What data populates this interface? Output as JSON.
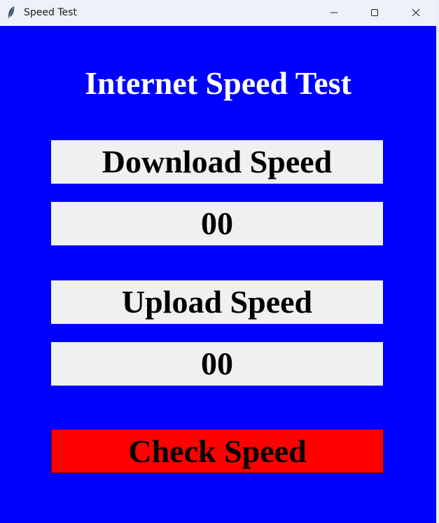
{
  "window": {
    "title": "Speed Test",
    "app_icon": "feather-icon",
    "controls": [
      "minimize-icon",
      "maximize-icon",
      "close-icon"
    ]
  },
  "app": {
    "heading": "Internet Speed Test",
    "download_label": "Download Speed",
    "download_value": "00",
    "upload_label": "Upload Speed",
    "upload_value": "00",
    "check_button": "Check Speed"
  },
  "colors": {
    "background": "#0000ff",
    "field": "#f0f0f0",
    "button": "#ff0000",
    "heading_text": "#ffffff"
  }
}
